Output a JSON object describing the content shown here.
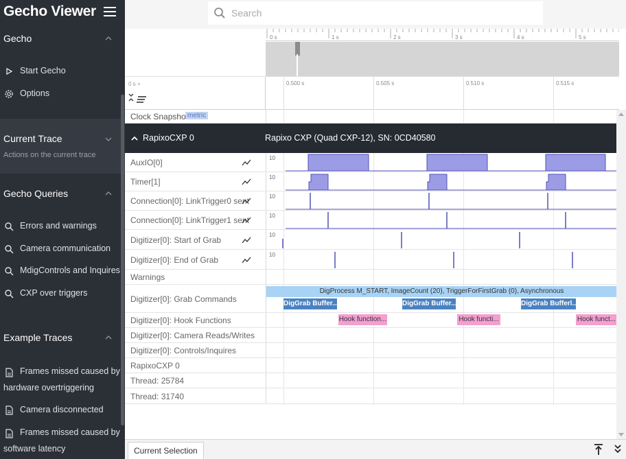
{
  "app": {
    "title": "Gecho Viewer"
  },
  "search": {
    "placeholder": "Search"
  },
  "sidebar": {
    "gecho": {
      "title": "Gecho",
      "items": [
        {
          "label": "Start Gecho",
          "icon": "play-icon"
        },
        {
          "label": "Options",
          "icon": "gear-icon"
        }
      ]
    },
    "current_trace": {
      "title": "Current Trace",
      "subtitle": "Actions on the current trace"
    },
    "queries": {
      "title": "Gecho Queries",
      "items": [
        {
          "label": "Errors and warnings",
          "icon": "search-icon"
        },
        {
          "label": "Camera communication",
          "icon": "search-icon"
        },
        {
          "label": "MdigControls and Inquires",
          "icon": "search-icon"
        },
        {
          "label": "CXP over triggers",
          "icon": "search-icon"
        }
      ]
    },
    "examples": {
      "title": "Example Traces",
      "items": [
        {
          "line1": "Frames missed caused by",
          "line2": "hardware overtriggering",
          "icon": "document-icon"
        },
        {
          "line1": "Camera disconnected",
          "line2": "",
          "icon": "document-icon"
        },
        {
          "line1": "Frames missed caused by",
          "line2": "software latency",
          "icon": "document-icon"
        }
      ]
    }
  },
  "overview": {
    "ticks": [
      "0 s",
      "1 s",
      "2 s",
      "3 s",
      "4 s",
      "5 s"
    ],
    "zoom_origin": "0 s +",
    "zoom_ticks": [
      "0.500 s",
      "0.505 s",
      "0.510 s",
      "0.515 s"
    ]
  },
  "tracks": {
    "clock_snapshots": {
      "label": "Clock Snapshots",
      "badge": "metric"
    },
    "header": {
      "name": "RapixoCXP 0",
      "description": "Rapixo CXP (Quad CXP-12), SN: 0CD40580"
    },
    "signal_scale": "10",
    "signals": [
      {
        "label": "AuxIO[0]"
      },
      {
        "label": "Timer[1]"
      },
      {
        "label": "Connection[0]: LinkTrigger0 sent"
      },
      {
        "label": "Connection[0]: LinkTrigger1 sent"
      },
      {
        "label": "Digitizer[0]: Start of Grab"
      },
      {
        "label": "Digitizer[0]: End of Grab"
      }
    ],
    "warnings": "Warnings",
    "grab_commands": {
      "label": "Digitizer[0]: Grab Commands",
      "top": "DigProcess M_START, ImageCount (20), TriggerForFirstGrab (0), Asynchronous",
      "slices": [
        "DigGrab Buffer...",
        "DigGrab Buffer...",
        "DigGrab Bufferl..."
      ]
    },
    "hook_functions": {
      "label": "Digitizer[0]: Hook Functions",
      "slices": [
        "Hook function...",
        "Hook functi...",
        "Hook funct..."
      ]
    },
    "others": [
      "Digitizer[0]: Camera Reads/Writes",
      "Digitizer[0]: Controls/Inquires",
      "RapixoCXP 0",
      "Thread: 25784",
      "Thread: 31740"
    ]
  },
  "bottom": {
    "tab": "Current Selection"
  },
  "colors": {
    "sidebar_bg": "#2b2f36",
    "header_bg": "#262a31",
    "signal_fill": "#9c9ce6",
    "signal_line": "#5151b8",
    "slice_blue": "#4a82c0",
    "slice_light": "#a9d3f5",
    "slice_pink": "#f39fd0"
  }
}
